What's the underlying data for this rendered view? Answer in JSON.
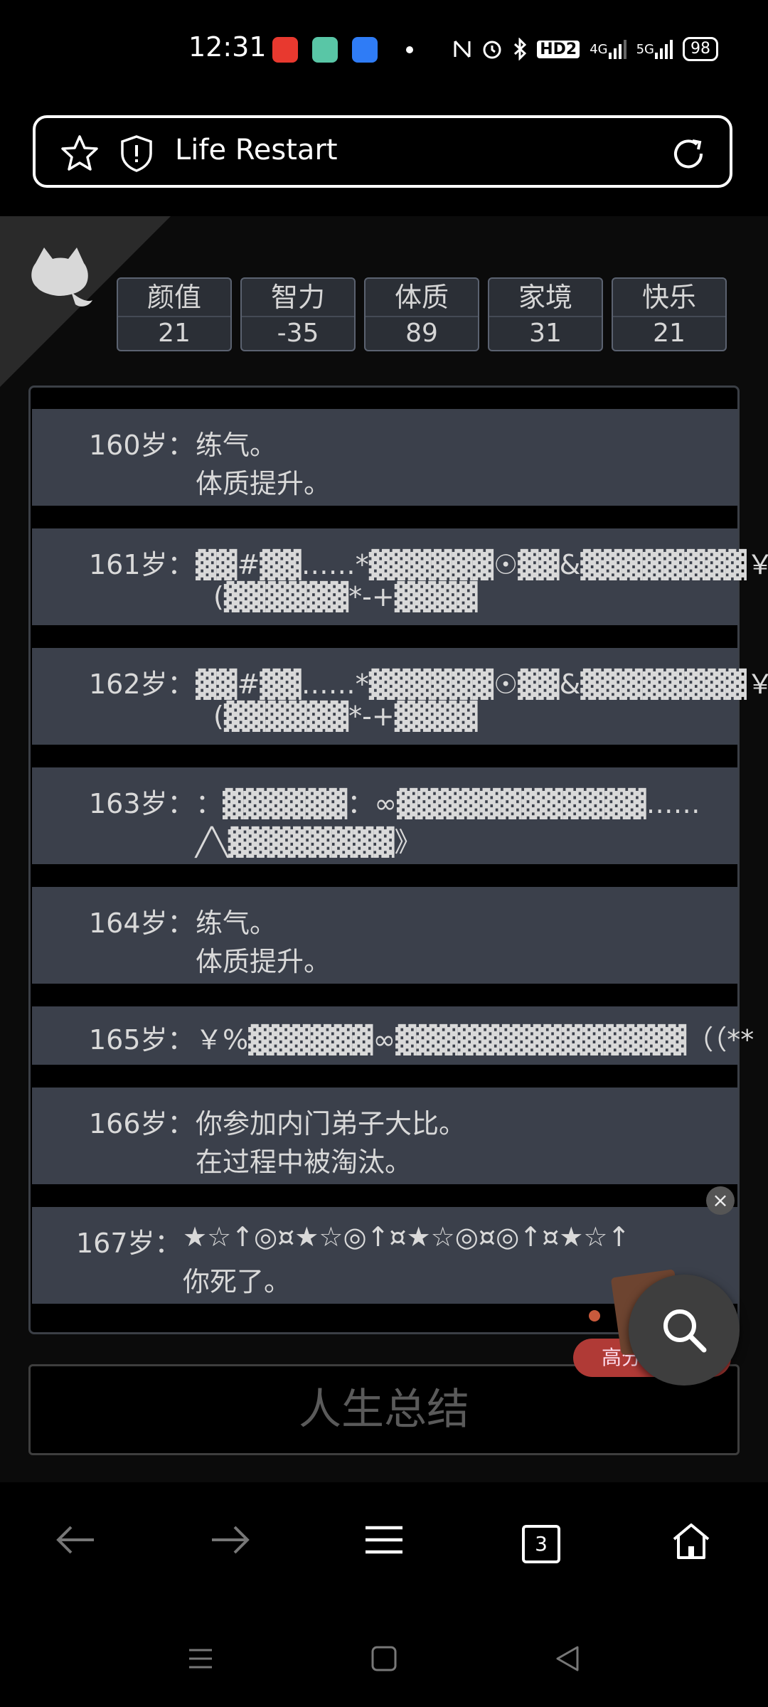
{
  "status_bar": {
    "time": "12:31",
    "net_4g": "4G",
    "net_5g": "5G",
    "hd": "HD2",
    "battery": "98"
  },
  "url_bar": {
    "title": "Life Restart"
  },
  "stats": [
    {
      "label": "颜值",
      "value": "21"
    },
    {
      "label": "智力",
      "value": "-35"
    },
    {
      "label": "体质",
      "value": "89"
    },
    {
      "label": "家境",
      "value": "31"
    },
    {
      "label": "快乐",
      "value": "21"
    }
  ],
  "events": [
    {
      "age": "160岁：",
      "lines": [
        "练气。",
        "体质提升。"
      ]
    },
    {
      "age": "161岁：",
      "lines": [
        "▓▓#▓▓……*▓▓▓▓▓▓☉▓▓&▓▓▓▓▓▓▓▓￥",
        "(▓▓▓▓▓▓*-+▓▓▓▓"
      ]
    },
    {
      "age": "162岁：",
      "lines": [
        "▓▓#▓▓……*▓▓▓▓▓▓☉▓▓&▓▓▓▓▓▓▓▓￥",
        "(▓▓▓▓▓▓*-+▓▓▓▓"
      ]
    },
    {
      "age": "163岁：",
      "lines": [
        "：▓▓▓▓▓▓：∞▓▓▓▓▓▓▓▓▓▓▓▓……",
        "╱╲▓▓▓▓▓▓▓▓》"
      ]
    },
    {
      "age": "164岁：",
      "lines": [
        "练气。",
        "体质提升。"
      ]
    },
    {
      "age": "165岁：",
      "lines": [
        "￥%▓▓▓▓▓▓∞▓▓▓▓▓▓▓▓▓▓▓▓▓▓（（**"
      ]
    },
    {
      "age": "166岁：",
      "lines": [
        "你参加内门弟子大比。",
        "在过程中被淘汰。"
      ]
    },
    {
      "age": "167岁：",
      "lines": [
        "★☆↑◎¤★☆◎↑¤★☆◎¤◎↑¤★☆↑",
        "你死了。"
      ]
    }
  ],
  "summary_button": "人生总结",
  "ad": {
    "pill_text": "高分",
    "close": "×"
  },
  "toolbar": {
    "tab_count": "3"
  }
}
